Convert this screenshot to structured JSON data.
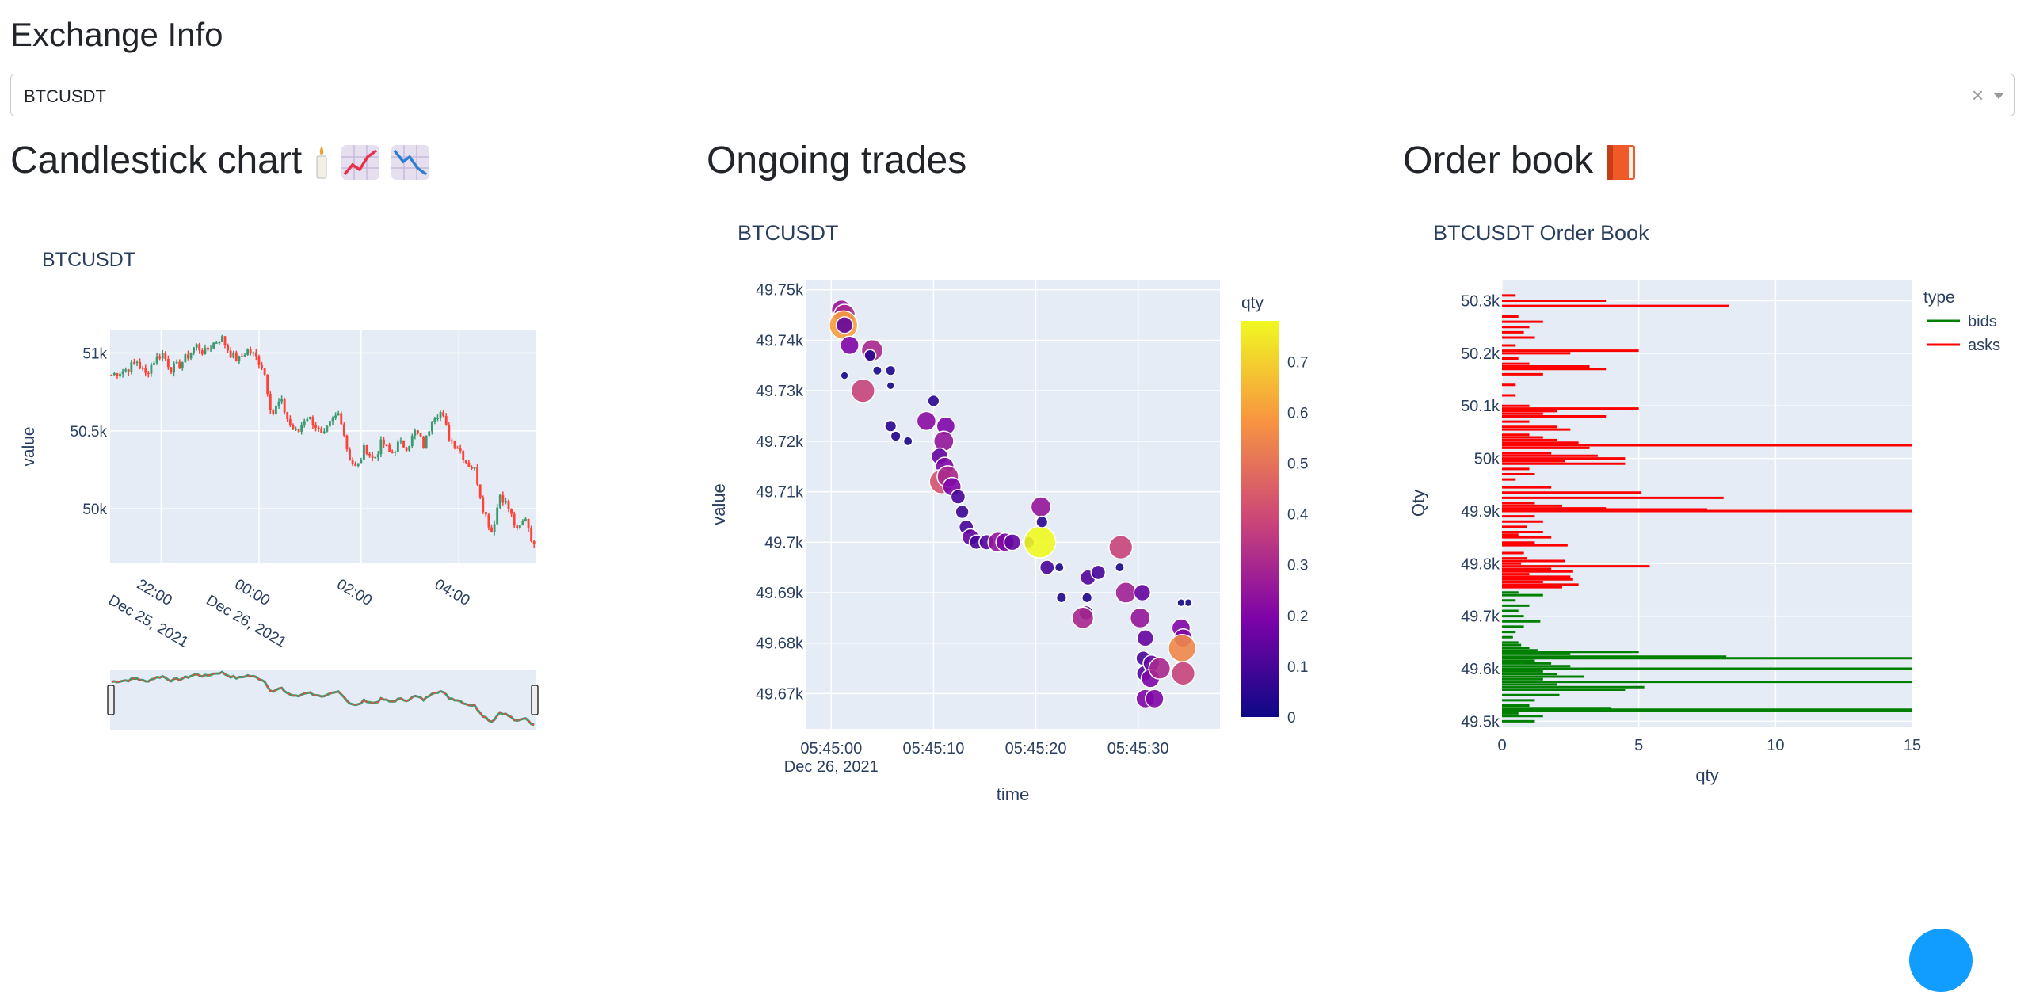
{
  "page": {
    "title": "Exchange Info",
    "symbol_select": {
      "value": "BTCUSDT",
      "clear_icon": "×",
      "arrow": "chevron-down-icon"
    }
  },
  "sections": {
    "candles": {
      "title": "Candlestick chart",
      "icons": [
        "candle-icon",
        "chart-increasing-icon",
        "chart-decreasing-icon"
      ]
    },
    "trades": {
      "title": "Ongoing trades"
    },
    "orderbook": {
      "title": "Order book",
      "icons": [
        "book-icon"
      ]
    }
  },
  "colors": {
    "plot_bg": "#e5ecf6",
    "grid": "#ffffff",
    "increasing": "#3d9970",
    "decreasing": "#ff4136",
    "bids": "#008000",
    "asks": "#ff0000",
    "fab": "#119dff"
  },
  "chart_data": [
    {
      "type": "candlestick",
      "title": "BTCUSDT",
      "ylabel": "value",
      "xlabel": "",
      "ylim": [
        49650,
        51150
      ],
      "x_ticks": [
        "22:00",
        "00:00",
        "02:00",
        "04:00"
      ],
      "x_tick_sub": [
        "Dec 25, 2021",
        "Dec 26, 2021",
        "",
        ""
      ],
      "y_ticks": [
        "50k",
        "50.5k",
        "51k"
      ],
      "close_path": [
        50860,
        50880,
        50900,
        50950,
        50860,
        50950,
        51000,
        50900,
        50920,
        50980,
        51050,
        51000,
        51060,
        51100,
        51000,
        50950,
        51020,
        50980,
        50900,
        50600,
        50700,
        50550,
        50480,
        50600,
        50550,
        50450,
        50560,
        50620,
        50350,
        50250,
        50400,
        50310,
        50430,
        50350,
        50420,
        50400,
        50500,
        50400,
        50600,
        50620,
        50450,
        50400,
        50300,
        50250,
        50000,
        49850,
        50100,
        50000,
        49850,
        49950,
        49750
      ],
      "range_slider": true
    },
    {
      "type": "scatter",
      "title": "BTCUSDT",
      "xlabel": "time",
      "ylabel": "value",
      "x_ticks": [
        "05:45:00",
        "05:45:10",
        "05:45:20",
        "05:45:30"
      ],
      "x_tick_sub": "Dec 26, 2021",
      "y_ticks": [
        "49.67k",
        "49.68k",
        "49.69k",
        "49.7k",
        "49.71k",
        "49.72k",
        "49.73k",
        "49.74k",
        "49.75k"
      ],
      "ylim": [
        49663,
        49752
      ],
      "xlim": [
        -2.5,
        38
      ],
      "colorbar": {
        "title": "qty",
        "ticks": [
          "0",
          "0.1",
          "0.2",
          "0.3",
          "0.4",
          "0.5",
          "0.6",
          "0.7"
        ],
        "max": 0.78
      },
      "points": [
        {
          "t": 1.0,
          "v": 49746,
          "q": 0.25
        },
        {
          "t": 1.3,
          "v": 49745,
          "q": 0.3
        },
        {
          "t": 1.2,
          "v": 49743,
          "q": 0.6
        },
        {
          "t": 1.3,
          "v": 49743,
          "q": 0.15
        },
        {
          "t": 1.8,
          "v": 49739,
          "q": 0.2
        },
        {
          "t": 4.0,
          "v": 49738,
          "q": 0.3
        },
        {
          "t": 3.8,
          "v": 49737,
          "q": 0.05
        },
        {
          "t": 4.5,
          "v": 49734,
          "q": 0.02
        },
        {
          "t": 5.8,
          "v": 49734,
          "q": 0.03
        },
        {
          "t": 3.1,
          "v": 49730,
          "q": 0.38
        },
        {
          "t": 1.3,
          "v": 49733,
          "q": 0.01
        },
        {
          "t": 5.8,
          "v": 49731,
          "q": 0.01
        },
        {
          "t": 5.8,
          "v": 49723,
          "q": 0.05
        },
        {
          "t": 6.3,
          "v": 49721,
          "q": 0.03
        },
        {
          "t": 7.5,
          "v": 49720,
          "q": 0.02
        },
        {
          "t": 10.0,
          "v": 49728,
          "q": 0.05
        },
        {
          "t": 9.3,
          "v": 49724,
          "q": 0.22
        },
        {
          "t": 11.2,
          "v": 49723,
          "q": 0.2
        },
        {
          "t": 11.0,
          "v": 49720,
          "q": 0.25
        },
        {
          "t": 10.6,
          "v": 49717,
          "q": 0.15
        },
        {
          "t": 11.1,
          "v": 49715,
          "q": 0.2
        },
        {
          "t": 10.8,
          "v": 49712,
          "q": 0.42
        },
        {
          "t": 11.4,
          "v": 49713,
          "q": 0.3
        },
        {
          "t": 11.8,
          "v": 49711,
          "q": 0.2
        },
        {
          "t": 12.4,
          "v": 49709,
          "q": 0.1
        },
        {
          "t": 12.8,
          "v": 49706,
          "q": 0.08
        },
        {
          "t": 13.2,
          "v": 49703,
          "q": 0.1
        },
        {
          "t": 13.6,
          "v": 49701,
          "q": 0.15
        },
        {
          "t": 14.2,
          "v": 49700,
          "q": 0.1
        },
        {
          "t": 15.2,
          "v": 49700,
          "q": 0.12
        },
        {
          "t": 16.3,
          "v": 49700,
          "q": 0.25
        },
        {
          "t": 17.0,
          "v": 49700,
          "q": 0.2
        },
        {
          "t": 17.7,
          "v": 49700,
          "q": 0.15
        },
        {
          "t": 19.3,
          "v": 49700,
          "q": 0.05
        },
        {
          "t": 20.4,
          "v": 49700,
          "q": 0.78
        },
        {
          "t": 20.5,
          "v": 49707,
          "q": 0.25
        },
        {
          "t": 20.6,
          "v": 49704,
          "q": 0.05
        },
        {
          "t": 21.1,
          "v": 49695,
          "q": 0.1
        },
        {
          "t": 22.3,
          "v": 49695,
          "q": 0.02
        },
        {
          "t": 22.5,
          "v": 49689,
          "q": 0.03
        },
        {
          "t": 25.1,
          "v": 49693,
          "q": 0.12
        },
        {
          "t": 26.1,
          "v": 49694,
          "q": 0.1
        },
        {
          "t": 28.3,
          "v": 49699,
          "q": 0.38
        },
        {
          "t": 28.2,
          "v": 49695,
          "q": 0.02
        },
        {
          "t": 25.0,
          "v": 49689,
          "q": 0.03
        },
        {
          "t": 24.9,
          "v": 49686,
          "q": 0.1
        },
        {
          "t": 24.6,
          "v": 49685,
          "q": 0.3
        },
        {
          "t": 28.8,
          "v": 49690,
          "q": 0.28
        },
        {
          "t": 30.4,
          "v": 49690,
          "q": 0.15
        },
        {
          "t": 30.2,
          "v": 49685,
          "q": 0.25
        },
        {
          "t": 30.7,
          "v": 49681,
          "q": 0.15
        },
        {
          "t": 30.5,
          "v": 49677,
          "q": 0.1
        },
        {
          "t": 30.6,
          "v": 49674,
          "q": 0.12
        },
        {
          "t": 31.3,
          "v": 49676,
          "q": 0.15
        },
        {
          "t": 31.2,
          "v": 49673,
          "q": 0.2
        },
        {
          "t": 30.7,
          "v": 49669,
          "q": 0.2
        },
        {
          "t": 31.6,
          "v": 49669,
          "q": 0.2
        },
        {
          "t": 32.1,
          "v": 49675,
          "q": 0.3
        },
        {
          "t": 34.2,
          "v": 49683,
          "q": 0.2
        },
        {
          "t": 34.4,
          "v": 49681,
          "q": 0.2
        },
        {
          "t": 34.3,
          "v": 49679,
          "q": 0.55
        },
        {
          "t": 34.4,
          "v": 49674,
          "q": 0.38
        },
        {
          "t": 34.9,
          "v": 49688,
          "q": 0.01
        },
        {
          "t": 34.2,
          "v": 49688,
          "q": 0.01
        }
      ]
    },
    {
      "type": "bar",
      "title": "BTCUSDT Order Book",
      "xlabel": "qty",
      "ylabel": "Qty",
      "x_ticks": [
        "0",
        "5",
        "10",
        "15"
      ],
      "y_ticks": [
        "49.5k",
        "49.6k",
        "49.7k",
        "49.8k",
        "49.9k",
        "50k",
        "50.1k",
        "50.2k",
        "50.3k"
      ],
      "xlim": [
        0,
        15
      ],
      "ylim": [
        49490,
        50340
      ],
      "legend": {
        "title": "type",
        "position": "top-right"
      },
      "series": [
        {
          "name": "bids",
          "color": "#008000",
          "levels": [
            [
              49500,
              1.2
            ],
            [
              49510,
              1.5
            ],
            [
              49515,
              0.6
            ],
            [
              49520,
              15
            ],
            [
              49522,
              15
            ],
            [
              49525,
              4
            ],
            [
              49530,
              1
            ],
            [
              49540,
              1.2
            ],
            [
              49550,
              2.1
            ],
            [
              49560,
              4.5
            ],
            [
              49565,
              5.2
            ],
            [
              49570,
              2
            ],
            [
              49575,
              15
            ],
            [
              49580,
              1.5
            ],
            [
              49585,
              3
            ],
            [
              49590,
              2
            ],
            [
              49595,
              1.5
            ],
            [
              49600,
              15
            ],
            [
              49605,
              2.5
            ],
            [
              49610,
              1.8
            ],
            [
              49615,
              1.2
            ],
            [
              49620,
              15
            ],
            [
              49623,
              8.2
            ],
            [
              49628,
              2.5
            ],
            [
              49632,
              5
            ],
            [
              49635,
              1.3
            ],
            [
              49640,
              1
            ],
            [
              49645,
              0.7
            ],
            [
              49650,
              0.6
            ],
            [
              49660,
              0.4
            ],
            [
              49670,
              0.5
            ],
            [
              49680,
              0.8
            ],
            [
              49690,
              1.4
            ],
            [
              49700,
              0.8
            ],
            [
              49710,
              0.6
            ],
            [
              49720,
              1
            ],
            [
              49730,
              0.5
            ],
            [
              49740,
              1.5
            ],
            [
              49745,
              0.6
            ]
          ]
        },
        {
          "name": "asks",
          "color": "#ff0000",
          "levels": [
            [
              49755,
              2.2
            ],
            [
              49760,
              2.8
            ],
            [
              49765,
              1.5
            ],
            [
              49770,
              2.6
            ],
            [
              49775,
              2.5
            ],
            [
              49780,
              1
            ],
            [
              49785,
              2.6
            ],
            [
              49790,
              1.8
            ],
            [
              49795,
              5.4
            ],
            [
              49800,
              0.7
            ],
            [
              49805,
              2.3
            ],
            [
              49810,
              0.9
            ],
            [
              49820,
              0.8
            ],
            [
              49835,
              2.4
            ],
            [
              49840,
              1.2
            ],
            [
              49850,
              1.8
            ],
            [
              49855,
              0.6
            ],
            [
              49860,
              1.5
            ],
            [
              49870,
              0.9
            ],
            [
              49880,
              1.5
            ],
            [
              49890,
              1.2
            ],
            [
              49900,
              15
            ],
            [
              49903,
              7.5
            ],
            [
              49905,
              3.8
            ],
            [
              49910,
              2.2
            ],
            [
              49915,
              1.2
            ],
            [
              49925,
              8.1
            ],
            [
              49935,
              5.1
            ],
            [
              49945,
              1.8
            ],
            [
              49960,
              0.5
            ],
            [
              49970,
              1.2
            ],
            [
              49980,
              1
            ],
            [
              49990,
              4.5
            ],
            [
              49995,
              2.3
            ],
            [
              50000,
              4.5
            ],
            [
              50005,
              3.5
            ],
            [
              50010,
              1.8
            ],
            [
              50020,
              3.2
            ],
            [
              50025,
              15
            ],
            [
              50030,
              2.8
            ],
            [
              50035,
              2
            ],
            [
              50040,
              1.5
            ],
            [
              50045,
              1
            ],
            [
              50055,
              2.5
            ],
            [
              50060,
              2
            ],
            [
              50070,
              1
            ],
            [
              50080,
              3.8
            ],
            [
              50085,
              1.5
            ],
            [
              50090,
              2
            ],
            [
              50095,
              5
            ],
            [
              50100,
              1
            ],
            [
              50120,
              0.5
            ],
            [
              50140,
              0.5
            ],
            [
              50160,
              1.5
            ],
            [
              50170,
              3.8
            ],
            [
              50175,
              3.2
            ],
            [
              50180,
              1
            ],
            [
              50190,
              0.6
            ],
            [
              50200,
              2.5
            ],
            [
              50205,
              5
            ],
            [
              50215,
              0.5
            ],
            [
              50230,
              1.2
            ],
            [
              50240,
              0.8
            ],
            [
              50250,
              1
            ],
            [
              50260,
              1.5
            ],
            [
              50270,
              0.6
            ],
            [
              50290,
              8.3
            ],
            [
              50300,
              3.8
            ],
            [
              50310,
              0.5
            ]
          ]
        }
      ]
    }
  ]
}
